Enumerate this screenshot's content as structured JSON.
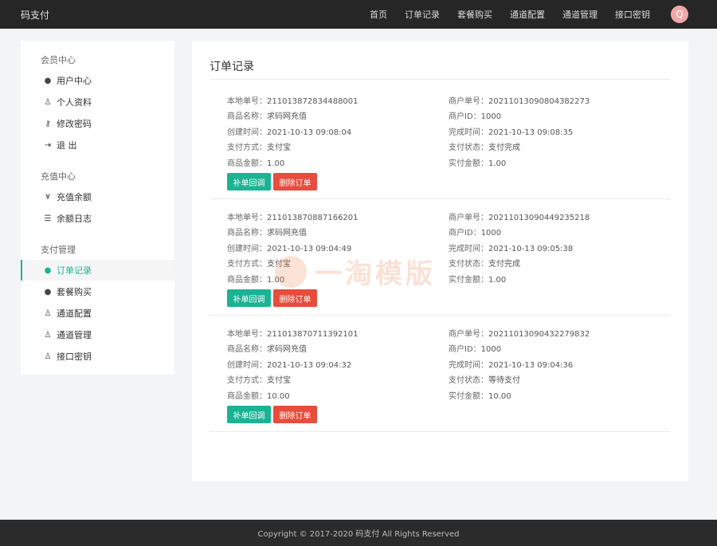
{
  "header": {
    "brand": "码支付",
    "nav": [
      "首页",
      "订单记录",
      "套餐购买",
      "通道配置",
      "通道管理",
      "接口密钥"
    ],
    "avatar_letter": "Q"
  },
  "sidebar": {
    "groups": [
      {
        "title": "会员中心",
        "items": [
          {
            "label": "用户中心",
            "icon": "user-circle-icon",
            "glyph": "●"
          },
          {
            "label": "个人资料",
            "icon": "user-icon",
            "glyph": "♙"
          },
          {
            "label": "修改密码",
            "icon": "key-icon",
            "glyph": "⚷"
          },
          {
            "label": "退 出",
            "icon": "sign-out-icon",
            "glyph": "⇥"
          }
        ]
      },
      {
        "title": "充值中心",
        "items": [
          {
            "label": "充值余额",
            "icon": "yen-icon",
            "glyph": "¥"
          },
          {
            "label": "余额日志",
            "icon": "list-icon",
            "glyph": "☰"
          }
        ]
      },
      {
        "title": "支付管理",
        "items": [
          {
            "label": "订单记录",
            "icon": "user-circle-icon",
            "glyph": "●",
            "active": true
          },
          {
            "label": "套餐购买",
            "icon": "user-circle-icon",
            "glyph": "●"
          },
          {
            "label": "通道配置",
            "icon": "user-icon",
            "glyph": "♙"
          },
          {
            "label": "通道管理",
            "icon": "user-icon",
            "glyph": "♙"
          },
          {
            "label": "接口密钥",
            "icon": "user-icon",
            "glyph": "♙"
          }
        ]
      }
    ]
  },
  "main": {
    "title": "订单记录",
    "labels": {
      "local_no": "本地单号：",
      "merchant_no": "商户单号：",
      "product": "商品名称：",
      "merchant_id": "商户ID：",
      "created": "创建时间：",
      "completed": "完成时间：",
      "pay_method": "支付方式：",
      "pay_status": "支付状态：",
      "amount": "商品金额：",
      "paid": "实付金额："
    },
    "buttons": {
      "callback": "补单回调",
      "delete": "删除订单"
    },
    "orders": [
      {
        "local_no": "211013872834488001",
        "merchant_no": "20211013090804382273",
        "product": "求码网充值",
        "merchant_id": "1000",
        "created": "2021-10-13 09:08:04",
        "completed": "2021-10-13 09:08:35",
        "pay_method": "支付宝",
        "pay_status": "支付完成",
        "amount": "1.00",
        "paid": "1.00"
      },
      {
        "local_no": "211013870887166201",
        "merchant_no": "20211013090449235218",
        "product": "求码网充值",
        "merchant_id": "1000",
        "created": "2021-10-13 09:04:49",
        "completed": "2021-10-13 09:05:38",
        "pay_method": "支付宝",
        "pay_status": "支付完成",
        "amount": "1.00",
        "paid": "1.00"
      },
      {
        "local_no": "211013870711392101",
        "merchant_no": "20211013090432279832",
        "product": "求码网充值",
        "merchant_id": "1000",
        "created": "2021-10-13 09:04:32",
        "completed": "2021-10-13 09:04:36",
        "pay_method": "支付宝",
        "pay_status": "等待支付",
        "amount": "10.00",
        "paid": "10.00"
      }
    ]
  },
  "watermark": "一淘模版",
  "footer": "Copyright © 2017-2020 码支付 All Rights Reserved"
}
